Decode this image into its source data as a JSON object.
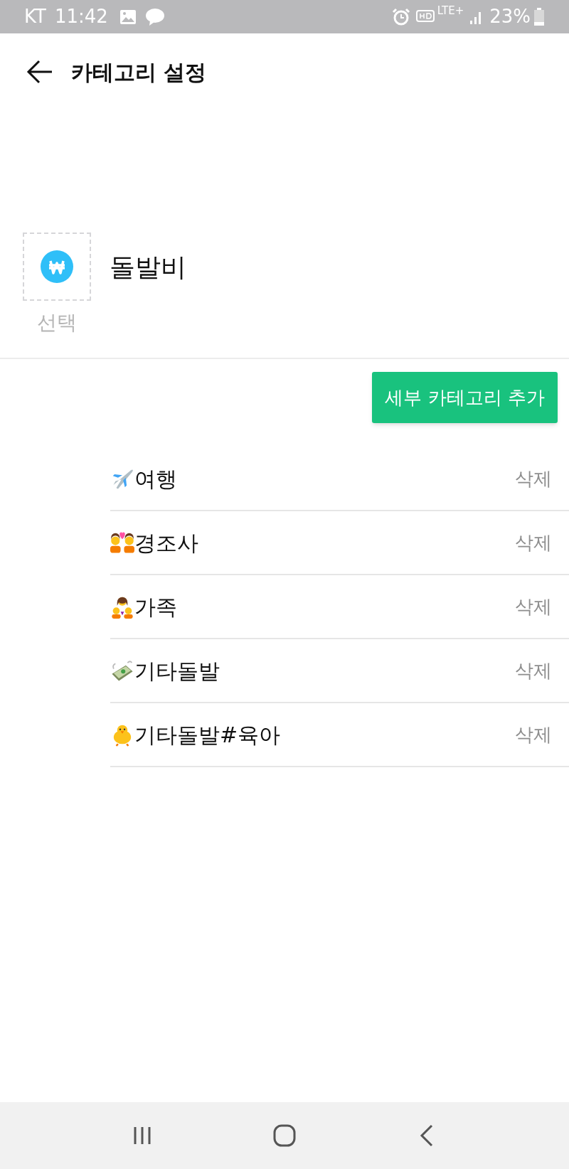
{
  "status_bar": {
    "carrier": "KT",
    "time": "11:42",
    "battery": "23%",
    "network": "LTE+"
  },
  "header": {
    "title": "카테고리 설정"
  },
  "category": {
    "icon_label": "선택",
    "name": "돌발비"
  },
  "add_button": "세부 카테고리 추가",
  "subcategories": [
    {
      "kind": "airplane",
      "label": "여행",
      "delete": "삭제"
    },
    {
      "kind": "couple",
      "label": "경조사",
      "delete": "삭제"
    },
    {
      "kind": "family",
      "label": "가족",
      "delete": "삭제"
    },
    {
      "kind": "money",
      "label": "기타돌발",
      "delete": "삭제"
    },
    {
      "kind": "chick",
      "label": "기타돌발#육아",
      "delete": "삭제"
    }
  ]
}
